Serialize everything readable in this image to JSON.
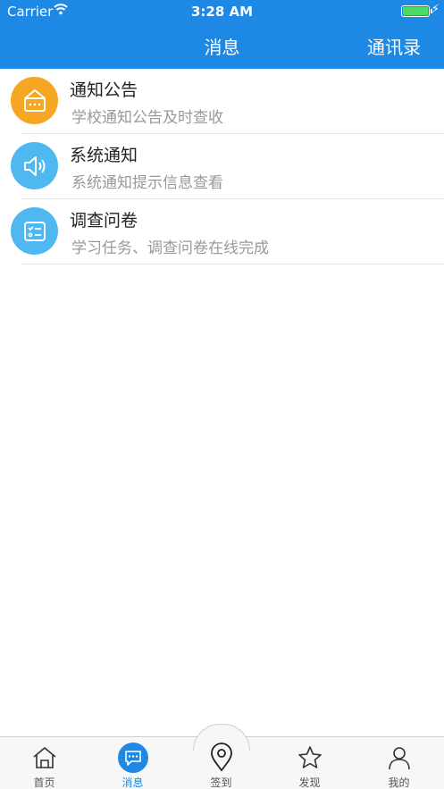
{
  "status_bar": {
    "carrier": "Carrier",
    "time": "3:28 AM"
  },
  "nav": {
    "title": "消息",
    "right_label": "通讯录"
  },
  "colors": {
    "header": "#1e88e5",
    "orange": "#f5a623",
    "blue": "#4fb8f0",
    "tab_active": "#1e88e5"
  },
  "items": [
    {
      "title": "通知公告",
      "subtitle": "学校通知公告及时查收",
      "icon": "mailbox-icon"
    },
    {
      "title": "系统通知",
      "subtitle": "系统通知提示信息查看",
      "icon": "speaker-icon"
    },
    {
      "title": "调查问卷",
      "subtitle": "学习任务、调查问卷在线完成",
      "icon": "checklist-icon"
    }
  ],
  "tabs": [
    {
      "label": "首页",
      "icon": "home-icon"
    },
    {
      "label": "消息",
      "icon": "message-icon",
      "active": true
    },
    {
      "label": "签到",
      "icon": "location-pin-icon"
    },
    {
      "label": "发现",
      "icon": "star-icon"
    },
    {
      "label": "我的",
      "icon": "person-icon"
    }
  ]
}
